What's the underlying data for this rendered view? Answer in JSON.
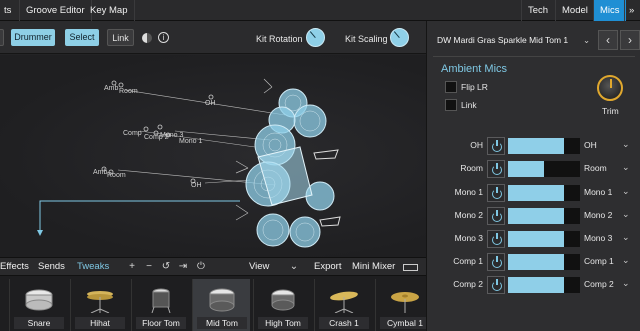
{
  "topbar": {
    "tabs": [
      "ts",
      "Groove Editor",
      "Key Map"
    ],
    "right_tabs": [
      "Tech",
      "Model",
      "Mics",
      "»"
    ]
  },
  "toolbar": {
    "drummer": "Drummer",
    "select": "Select",
    "link": "Link",
    "kit_rotation": "Kit Rotation",
    "kit_scaling": "Kit Scaling"
  },
  "canvas": {
    "labels": [
      "Amb",
      "Room",
      "OH",
      "Comp",
      "Comp 2",
      "Mono 3",
      "Mono 1",
      "Amb",
      "Room",
      "OH"
    ]
  },
  "bottom_tabs": {
    "effects": "Effects",
    "sends": "Sends",
    "tweaks": "Tweaks",
    "view": "View",
    "export": "Export",
    "mini_mixer": "Mini Mixer"
  },
  "instruments": [
    "Snare",
    "Hihat",
    "Floor Tom",
    "Mid Tom",
    "High Tom",
    "Crash 1",
    "Cymbal 1"
  ],
  "right": {
    "kit_name": "DW Mardi Gras Sparkle Mid Tom 1",
    "section_title": "Ambient Mics",
    "flip_lr": "Flip LR",
    "link": "Link",
    "trim": "Trim",
    "mics": [
      {
        "name": "OH",
        "route": "OH",
        "level": 0.78
      },
      {
        "name": "Room",
        "route": "Room",
        "level": 0.5
      },
      {
        "name": "Mono 1",
        "route": "Mono 1",
        "level": 0.78
      },
      {
        "name": "Mono 2",
        "route": "Mono 2",
        "level": 0.78
      },
      {
        "name": "Mono 3",
        "route": "Mono 3",
        "level": 0.78
      },
      {
        "name": "Comp 1",
        "route": "Comp 1",
        "level": 0.78
      },
      {
        "name": "Comp 2",
        "route": "Comp 2",
        "level": 0.78
      }
    ]
  },
  "colors": {
    "accent": "#1f8fd4",
    "drum": "#8fcfe8",
    "section": "#7fc8e4"
  }
}
